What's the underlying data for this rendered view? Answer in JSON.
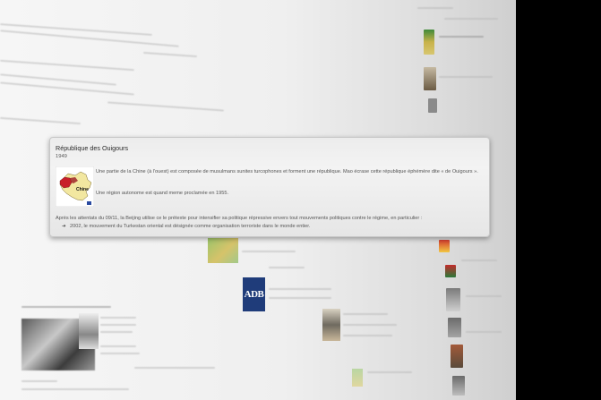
{
  "popup": {
    "title": "République des Ouigours",
    "year": "1949",
    "paragraph1": "Une partie de la Chine (à l'ouest) est composée de musulmans sunites turcophones et forment une république. Mao écrase cette république éphémère dite « de Ouigours ».",
    "paragraph2": "Une région autonome est quand meme proclamée en 1955.",
    "paragraph3": "Après les attentats du 09/11, la Beijing utilise ce le prétexte pour intensifier sa politique répressive envers tout mouvements politiques contre le régime, en particulier :",
    "paragraph4": "2002, le mouvement du Turkestan oriental est désignée comme  organisation terroriste dans le monde entier.",
    "map_label": "Chine"
  },
  "background": {
    "adb_logo": "ADB"
  },
  "colors": {
    "region_highlight": "#c8202a",
    "map_land": "#f2e7a0",
    "adb_blue": "#1f3c7a"
  }
}
